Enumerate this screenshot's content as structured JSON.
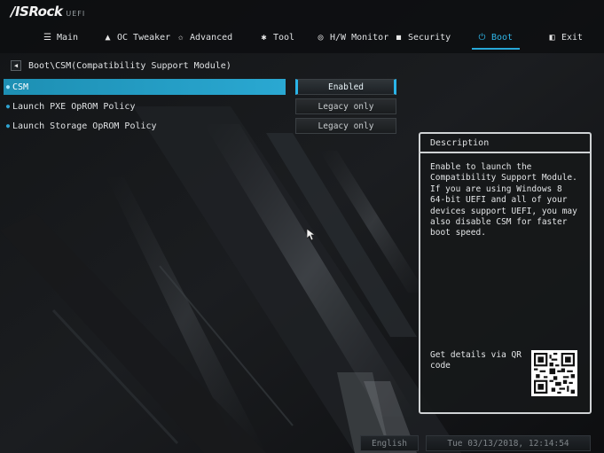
{
  "brand": {
    "name": "/ISRock",
    "sub": "UEFI"
  },
  "nav": {
    "tabs": [
      {
        "label": "Main",
        "icon": "list-icon",
        "active": false
      },
      {
        "label": "OC Tweaker",
        "icon": "rocket-icon",
        "active": false
      },
      {
        "label": "Advanced",
        "icon": "star-icon",
        "active": false
      },
      {
        "label": "Tool",
        "icon": "wrench-icon",
        "active": false
      },
      {
        "label": "H/W Monitor",
        "icon": "gauge-icon",
        "active": false
      },
      {
        "label": "Security",
        "icon": "shield-icon",
        "active": false
      },
      {
        "label": "Boot",
        "icon": "power-icon",
        "active": true
      },
      {
        "label": "Exit",
        "icon": "exit-icon",
        "active": false
      }
    ]
  },
  "breadcrumb": {
    "path": "Boot\\CSM(Compatibility Support Module)"
  },
  "settings": [
    {
      "label": "CSM",
      "value": "Enabled",
      "selected": true
    },
    {
      "label": "Launch PXE OpROM Policy",
      "value": "Legacy only",
      "selected": false
    },
    {
      "label": "Launch Storage OpROM Policy",
      "value": "Legacy only",
      "selected": false
    }
  ],
  "description": {
    "title": "Description",
    "text": "Enable to launch the\nCompatibility Support Module.\nIf you are using Windows 8\n64-bit UEFI and all of your\ndevices support UEFI, you may\nalso disable CSM for faster\nboot speed.",
    "qr_text": "Get details via QR\ncode"
  },
  "footer": {
    "language": "English",
    "datetime": "Tue 03/13/2018, 12:14:54"
  },
  "colors": {
    "accent": "#2fb6e8",
    "selected_row": "#2aa8d2",
    "panel_border": "#cfd2d4"
  }
}
